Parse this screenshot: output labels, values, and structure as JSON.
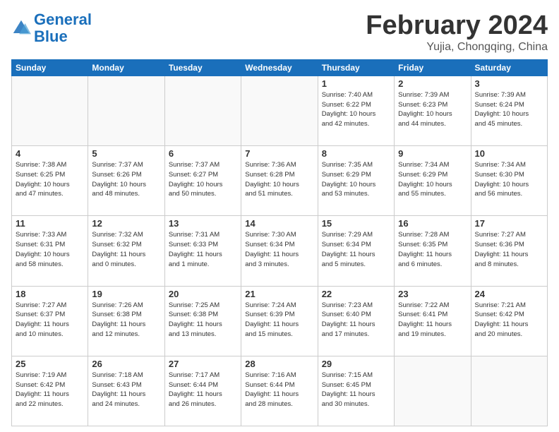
{
  "header": {
    "logo_general": "General",
    "logo_blue": "Blue",
    "month_title": "February 2024",
    "subtitle": "Yujia, Chongqing, China"
  },
  "weekdays": [
    "Sunday",
    "Monday",
    "Tuesday",
    "Wednesday",
    "Thursday",
    "Friday",
    "Saturday"
  ],
  "weeks": [
    [
      {
        "day": "",
        "info": ""
      },
      {
        "day": "",
        "info": ""
      },
      {
        "day": "",
        "info": ""
      },
      {
        "day": "",
        "info": ""
      },
      {
        "day": "1",
        "info": "Sunrise: 7:40 AM\nSunset: 6:22 PM\nDaylight: 10 hours\nand 42 minutes."
      },
      {
        "day": "2",
        "info": "Sunrise: 7:39 AM\nSunset: 6:23 PM\nDaylight: 10 hours\nand 44 minutes."
      },
      {
        "day": "3",
        "info": "Sunrise: 7:39 AM\nSunset: 6:24 PM\nDaylight: 10 hours\nand 45 minutes."
      }
    ],
    [
      {
        "day": "4",
        "info": "Sunrise: 7:38 AM\nSunset: 6:25 PM\nDaylight: 10 hours\nand 47 minutes."
      },
      {
        "day": "5",
        "info": "Sunrise: 7:37 AM\nSunset: 6:26 PM\nDaylight: 10 hours\nand 48 minutes."
      },
      {
        "day": "6",
        "info": "Sunrise: 7:37 AM\nSunset: 6:27 PM\nDaylight: 10 hours\nand 50 minutes."
      },
      {
        "day": "7",
        "info": "Sunrise: 7:36 AM\nSunset: 6:28 PM\nDaylight: 10 hours\nand 51 minutes."
      },
      {
        "day": "8",
        "info": "Sunrise: 7:35 AM\nSunset: 6:29 PM\nDaylight: 10 hours\nand 53 minutes."
      },
      {
        "day": "9",
        "info": "Sunrise: 7:34 AM\nSunset: 6:29 PM\nDaylight: 10 hours\nand 55 minutes."
      },
      {
        "day": "10",
        "info": "Sunrise: 7:34 AM\nSunset: 6:30 PM\nDaylight: 10 hours\nand 56 minutes."
      }
    ],
    [
      {
        "day": "11",
        "info": "Sunrise: 7:33 AM\nSunset: 6:31 PM\nDaylight: 10 hours\nand 58 minutes."
      },
      {
        "day": "12",
        "info": "Sunrise: 7:32 AM\nSunset: 6:32 PM\nDaylight: 11 hours\nand 0 minutes."
      },
      {
        "day": "13",
        "info": "Sunrise: 7:31 AM\nSunset: 6:33 PM\nDaylight: 11 hours\nand 1 minute."
      },
      {
        "day": "14",
        "info": "Sunrise: 7:30 AM\nSunset: 6:34 PM\nDaylight: 11 hours\nand 3 minutes."
      },
      {
        "day": "15",
        "info": "Sunrise: 7:29 AM\nSunset: 6:34 PM\nDaylight: 11 hours\nand 5 minutes."
      },
      {
        "day": "16",
        "info": "Sunrise: 7:28 AM\nSunset: 6:35 PM\nDaylight: 11 hours\nand 6 minutes."
      },
      {
        "day": "17",
        "info": "Sunrise: 7:27 AM\nSunset: 6:36 PM\nDaylight: 11 hours\nand 8 minutes."
      }
    ],
    [
      {
        "day": "18",
        "info": "Sunrise: 7:27 AM\nSunset: 6:37 PM\nDaylight: 11 hours\nand 10 minutes."
      },
      {
        "day": "19",
        "info": "Sunrise: 7:26 AM\nSunset: 6:38 PM\nDaylight: 11 hours\nand 12 minutes."
      },
      {
        "day": "20",
        "info": "Sunrise: 7:25 AM\nSunset: 6:38 PM\nDaylight: 11 hours\nand 13 minutes."
      },
      {
        "day": "21",
        "info": "Sunrise: 7:24 AM\nSunset: 6:39 PM\nDaylight: 11 hours\nand 15 minutes."
      },
      {
        "day": "22",
        "info": "Sunrise: 7:23 AM\nSunset: 6:40 PM\nDaylight: 11 hours\nand 17 minutes."
      },
      {
        "day": "23",
        "info": "Sunrise: 7:22 AM\nSunset: 6:41 PM\nDaylight: 11 hours\nand 19 minutes."
      },
      {
        "day": "24",
        "info": "Sunrise: 7:21 AM\nSunset: 6:42 PM\nDaylight: 11 hours\nand 20 minutes."
      }
    ],
    [
      {
        "day": "25",
        "info": "Sunrise: 7:19 AM\nSunset: 6:42 PM\nDaylight: 11 hours\nand 22 minutes."
      },
      {
        "day": "26",
        "info": "Sunrise: 7:18 AM\nSunset: 6:43 PM\nDaylight: 11 hours\nand 24 minutes."
      },
      {
        "day": "27",
        "info": "Sunrise: 7:17 AM\nSunset: 6:44 PM\nDaylight: 11 hours\nand 26 minutes."
      },
      {
        "day": "28",
        "info": "Sunrise: 7:16 AM\nSunset: 6:44 PM\nDaylight: 11 hours\nand 28 minutes."
      },
      {
        "day": "29",
        "info": "Sunrise: 7:15 AM\nSunset: 6:45 PM\nDaylight: 11 hours\nand 30 minutes."
      },
      {
        "day": "",
        "info": ""
      },
      {
        "day": "",
        "info": ""
      }
    ]
  ]
}
